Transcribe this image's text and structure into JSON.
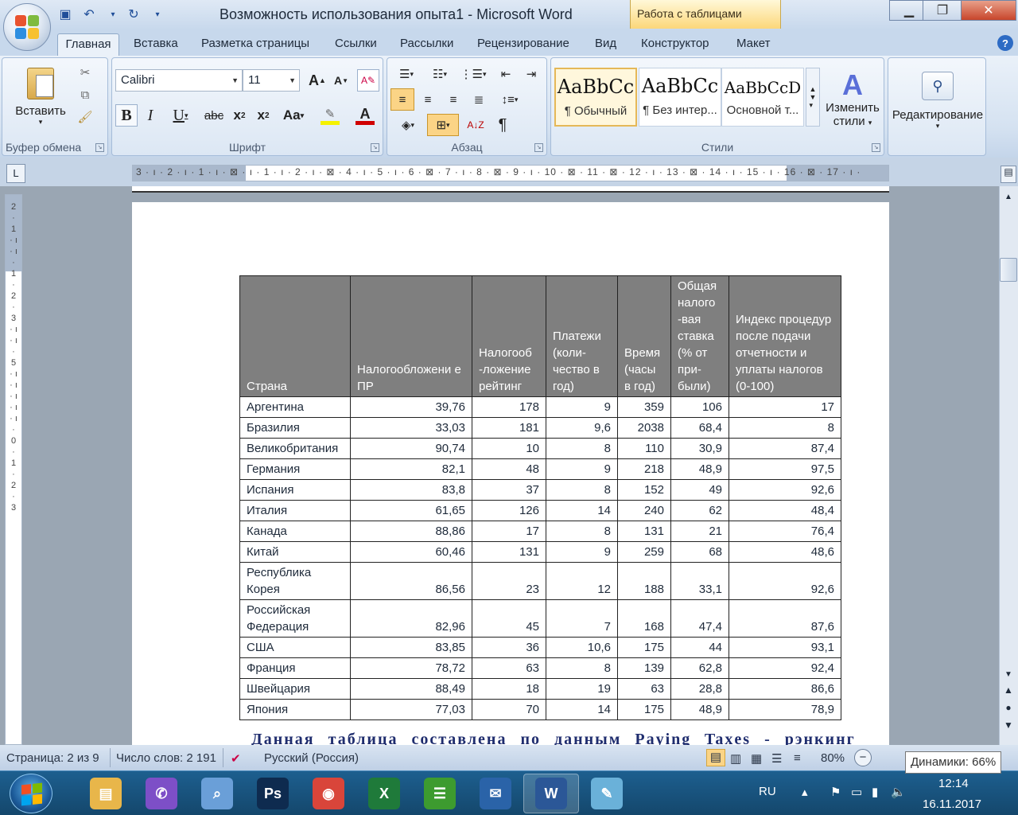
{
  "window": {
    "title": "Возможность использования опыта1 - Microsoft Word",
    "context_tab": "Работа с таблицами"
  },
  "tabs": [
    "Главная",
    "Вставка",
    "Разметка страницы",
    "Ссылки",
    "Рассылки",
    "Рецензирование",
    "Вид",
    "Конструктор",
    "Макет"
  ],
  "ribbon": {
    "clipboard": {
      "paste_label": "Вставить",
      "group_label": "Буфер обмена"
    },
    "font": {
      "font_name": "Calibri",
      "font_size": "11",
      "group_label": "Шрифт"
    },
    "paragraph": {
      "group_label": "Абзац"
    },
    "styles": {
      "group_label": "Стили",
      "items": [
        {
          "sample": "AaBbCc",
          "name": "¶ Обычный"
        },
        {
          "sample": "AaBbCc",
          "name": "¶ Без интер..."
        },
        {
          "sample": "AaBbCcD",
          "name": "Основной т..."
        }
      ],
      "change_label_1": "Изменить",
      "change_label_2": "стили"
    },
    "editing": {
      "label": "Редактирование"
    }
  },
  "ruler": {
    "text": "3 · ı · 2 · ı · 1 · ı · ⊠ · ı · 1 · ı · 2 · ı · ⊠ · 4 · ı · 5 · ı · 6 · ⊠ · 7 · ı · 8 · ⊠ · 9 · ı · 10 · ⊠ · 11 · ⊠ · 12 · ı · 13 · ⊠ · 14 · ı · 15 · ı · 16 · ⊠ · 17 · ı ·"
  },
  "table": {
    "headers": [
      "Страна",
      "Налогообложени е ПР",
      "Налогооб -ложение рейтинг",
      "Платежи (коли- чество в год)",
      "Время (часы в год)",
      "Общая налого -вая ставка (% от при- были)",
      "Индекс процедур после подачи отчетности и уплаты налогов (0-100)"
    ],
    "rows": [
      [
        "Аргентина",
        "39,76",
        "178",
        "9",
        "359",
        "106",
        "17"
      ],
      [
        "Бразилия",
        "33,03",
        "181",
        "9,6",
        "2038",
        "68,4",
        "8"
      ],
      [
        "Великобритания",
        "90,74",
        "10",
        "8",
        "110",
        "30,9",
        "87,4"
      ],
      [
        "Германия",
        "82,1",
        "48",
        "9",
        "218",
        "48,9",
        "97,5"
      ],
      [
        "Испания",
        "83,8",
        "37",
        "8",
        "152",
        "49",
        "92,6"
      ],
      [
        "Италия",
        "61,65",
        "126",
        "14",
        "240",
        "62",
        "48,4"
      ],
      [
        "Канада",
        "88,86",
        "17",
        "8",
        "131",
        "21",
        "76,4"
      ],
      [
        "Китай",
        "60,46",
        "131",
        "9",
        "259",
        "68",
        "48,6"
      ],
      [
        "Республика Корея",
        "86,56",
        "23",
        "12",
        "188",
        "33,1",
        "92,6"
      ],
      [
        "Российская Федерация",
        "82,96",
        "45",
        "7",
        "168",
        "47,4",
        "87,6"
      ],
      [
        "США",
        "83,85",
        "36",
        "10,6",
        "175",
        "44",
        "93,1"
      ],
      [
        "Франция",
        "78,72",
        "63",
        "8",
        "139",
        "62,8",
        "92,4"
      ],
      [
        "Швейцария",
        "88,49",
        "18",
        "19",
        "63",
        "28,8",
        "86,6"
      ],
      [
        "Япония",
        "77,03",
        "70",
        "14",
        "175",
        "48,9",
        "78,9"
      ]
    ]
  },
  "caption": "Данная таблица составлена по данным Paying Taxes - рэнкинг",
  "status": {
    "page": "Страница: 2 из 9",
    "words": "Число слов: 2 191",
    "language": "Русский (Россия)",
    "zoom": "80%",
    "tooltip": "Динамики: 66%"
  },
  "taskbar": {
    "apps": [
      {
        "name": "explorer",
        "glyph": "▤",
        "color": "#e8b64a"
      },
      {
        "name": "viber",
        "glyph": "✆",
        "color": "#7d4fc7"
      },
      {
        "name": "search",
        "glyph": "⌕",
        "color": "#6a9fd8"
      },
      {
        "name": "photoshop",
        "glyph": "Ps",
        "color": "#0e2b4f"
      },
      {
        "name": "chrome",
        "glyph": "◉",
        "color": "#d9453a"
      },
      {
        "name": "excel",
        "glyph": "X",
        "color": "#1f7a3a"
      },
      {
        "name": "project",
        "glyph": "☰",
        "color": "#3d9b2f"
      },
      {
        "name": "thunderbird",
        "glyph": "✉",
        "color": "#2a63a8"
      },
      {
        "name": "word",
        "glyph": "W",
        "color": "#2b5797"
      },
      {
        "name": "notepad",
        "glyph": "✎",
        "color": "#6ab1d9"
      }
    ],
    "lang": "RU",
    "time": "12:14",
    "date": "16.11.2017"
  }
}
